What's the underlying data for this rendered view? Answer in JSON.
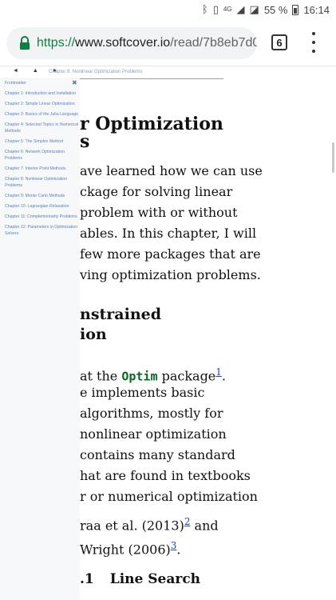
{
  "status_bar": {
    "network": "4G",
    "battery_percent": "55 %",
    "time": "16:14",
    "icons": [
      "bluetooth-icon",
      "vibrate-icon",
      "signal-icon",
      "no-sim-icon",
      "battery-icon"
    ]
  },
  "browser": {
    "url_scheme": "https://",
    "url_host": "www.softcover.io",
    "url_path": "/read/7b8eb7d0",
    "tab_count": "6",
    "accent_color": "#0b8043"
  },
  "reader": {
    "nav_arrows": "◄ ▲ ►",
    "current_chapter": "Chapter 8: Nonlinear Optimization Problems",
    "toc_close": "✖",
    "toc": [
      "Frontmatter",
      "Chapter 1: Introduction and Installation",
      "Chapter 2: Simple Linear Optimization",
      "Chapter 3: Basics of the Julia Language",
      "Chapter 4: Selected Topics in Numerical Methods",
      "Chapter 5: The Simplex Method",
      "Chapter 6: Network Optimization Problems",
      "Chapter 7: Interior Point Methods",
      "Chapter 8: Nonlinear Optimization Problems",
      "Chapter 9: Monte Carlo Methods",
      "Chapter 10: Lagrangian Relaxation",
      "Chapter 11: Complementarity Problems",
      "Chapter 12: Parameters in Optimization Solvers"
    ]
  },
  "article": {
    "heading_line1": "r Optimization",
    "heading_line2": "s",
    "intro": [
      "ave learned how we can use",
      "ckage for solving linear",
      "problem with or without",
      "ables. In this chapter, I will",
      "few more packages that are",
      "ving optimization problems."
    ],
    "section_line1": "nstrained",
    "section_line2": "ion",
    "para_line1_pre": "at the ",
    "para_line1_code": "Optim",
    "para_line1_post": " package",
    "footnote1": "1",
    "para_line1_end": ".",
    "para_lines": [
      "e implements basic",
      "algorithms, mostly for",
      "nonlinear optimization",
      "contains many standard",
      "hat are found in textbooks",
      "r or numerical optimization"
    ],
    "cite1": "raa et al. (2013)",
    "footnote2": "2",
    "cite1_end": " and",
    "cite2": "Wright (2006)",
    "footnote3": "3",
    "cite2_end": ".",
    "subsection_number": ".1",
    "subsection_title": "Line Search"
  }
}
